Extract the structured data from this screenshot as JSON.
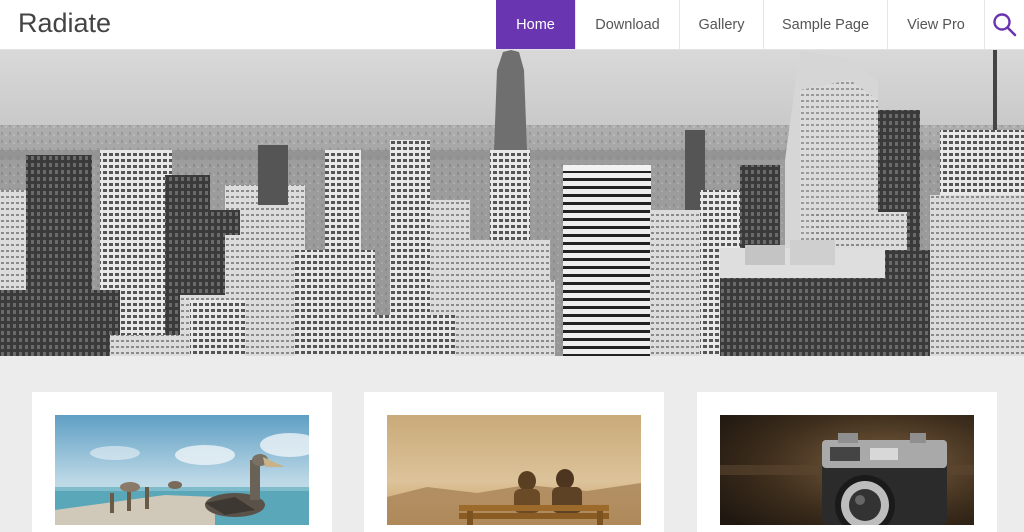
{
  "site": {
    "title": "Radiate"
  },
  "nav": {
    "items": [
      {
        "label": "Home",
        "active": true
      },
      {
        "label": "Download",
        "active": false
      },
      {
        "label": "Gallery",
        "active": false
      },
      {
        "label": "Sample Page",
        "active": false
      },
      {
        "label": "View Pro",
        "active": false
      }
    ],
    "search_icon": "search-icon"
  },
  "hero": {
    "image": "city-skyline-grayscale"
  },
  "cards": [
    {
      "image": "pelican-pier-photo"
    },
    {
      "image": "couple-on-bench-photo"
    },
    {
      "image": "vintage-camera-photo"
    }
  ],
  "colors": {
    "accent": "#6a35b1",
    "background": "#ececec",
    "header": "#ffffff"
  }
}
